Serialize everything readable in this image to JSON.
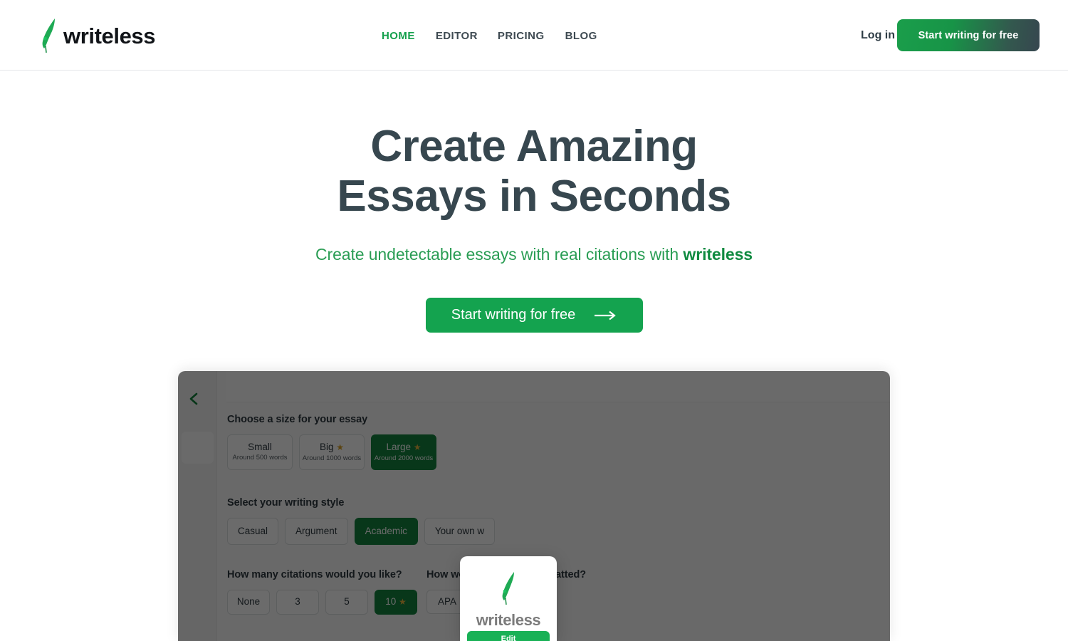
{
  "header": {
    "logo_text": "writeless",
    "logo_icon": "feather-quill-icon",
    "nav": [
      {
        "label": "HOME",
        "active": true
      },
      {
        "label": "EDITOR",
        "active": false
      },
      {
        "label": "PRICING",
        "active": false
      },
      {
        "label": "BLOG",
        "active": false
      }
    ],
    "login_label": "Log in",
    "cta_label": "Start writing for free"
  },
  "hero": {
    "title_line1": "Create Amazing",
    "title_line2": "Essays in Seconds",
    "subtitle_prefix": "Create undetectable essays with real citations with ",
    "subtitle_brand": "writeless",
    "cta_label": "Start writing for free",
    "cta_icon": "arrow-right-icon"
  },
  "panel": {
    "back_icon": "chevron-left-icon",
    "size_section": {
      "label": "Choose a size for your essay",
      "options": [
        {
          "main": "Small",
          "sub": "Around 500 words",
          "star": false,
          "selected": false
        },
        {
          "main": "Big",
          "sub": "Around 1000 words",
          "star": true,
          "selected": false
        },
        {
          "main": "Large",
          "sub": "Around 2000 words",
          "star": true,
          "selected": true
        }
      ]
    },
    "style_section": {
      "label": "Select your writing style",
      "options": [
        {
          "main": "Casual",
          "selected": false
        },
        {
          "main": "Argument",
          "selected": false
        },
        {
          "main": "Academic",
          "selected": true
        },
        {
          "main": "Your own w",
          "selected": false
        }
      ]
    },
    "citations_section": {
      "label": "How many citations would you like?",
      "options": [
        {
          "main": "None",
          "selected": false
        },
        {
          "main": "3",
          "selected": false
        },
        {
          "main": "5",
          "selected": false
        },
        {
          "main": "10",
          "star": true,
          "selected": true
        }
      ]
    },
    "format_section": {
      "label": "How would you like it formatted?",
      "label_visible_start": "How w",
      "label_visible_end": "rmatted?",
      "options": [
        {
          "main": "APA",
          "selected": false
        }
      ]
    }
  },
  "popup": {
    "logo_icon": "feather-quill-icon",
    "title": "writeless",
    "button_label": "Edit"
  },
  "colors": {
    "brand_green": "#14a04c",
    "cta_green": "#14a34f",
    "heading_slate": "#37474f",
    "nav_gray": "#3e4a52",
    "selected_green": "#13833f",
    "star_gold": "#d8a024",
    "overlay": "rgba(0,0,0,0.58)"
  }
}
